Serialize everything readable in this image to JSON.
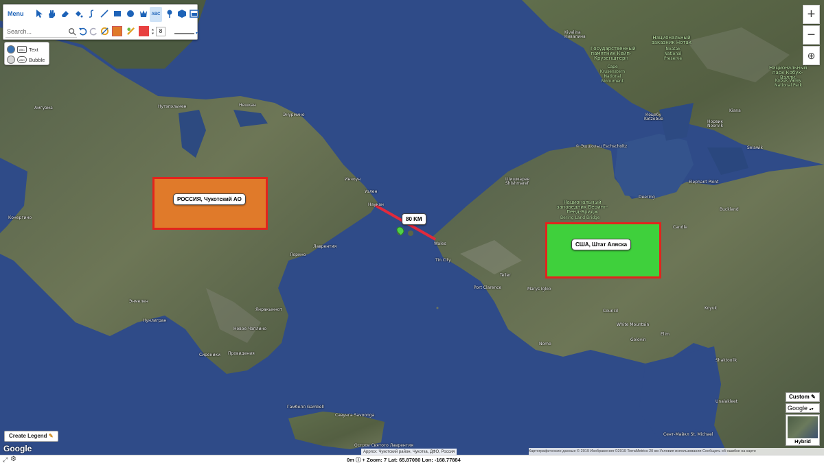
{
  "toolbar": {
    "menu_label": "Menu",
    "search_placeholder": "Search...",
    "abc_label": "ABC",
    "size_value": "8"
  },
  "layers": {
    "text_label": "Text",
    "bubble_label": "Bubble"
  },
  "zoom": {
    "in": "+",
    "out": "−"
  },
  "regions": {
    "russia": {
      "label": "РОССИЯ, Чукотский АО",
      "color": "#e07a2a"
    },
    "usa": {
      "label": "США, Штат Аляска",
      "color": "#3fd03c"
    }
  },
  "distance_label": "80 KM",
  "legend_button": "Create Legend",
  "google_logo": "Google",
  "maptype": {
    "custom": "Custom",
    "select": "Google",
    "hybrid": "Hybrid"
  },
  "approx": "Approx: Чукотский район, Чукотка, ДФО, Россия",
  "attribution": "Картографические данные © 2019 Изображения ©2019 TerraMetrics   20 км   Условия использования   Сообщить об ошибке на карте",
  "status": {
    "elevation": "0m",
    "zoom": "Zoom: 7",
    "lat": "Lat: 65.87080",
    "lon": "Lon: -168.77884"
  },
  "place_labels": {
    "kivalina": "Kivalina",
    "kivalina_ru": "Кивалина",
    "noatak_ru": "Национальный заказник Нотак",
    "noatak": "Noatak National Preserve",
    "krusenstern_ru": "Государственный памятник Кейп-Крузенштерн",
    "krusenstern": "Cape Krusenstern National Monument",
    "kobuk_ru": "Национальный парк Кобук-Вэлли",
    "kobuk": "Kobuk Valley National Park",
    "kotzebue": "Kotzebue",
    "kotzebue_ru": "Коцебу",
    "noorvik": "Noorvik",
    "noorvik_ru": "Норвик",
    "kiana": "Kiana",
    "selawik": "Selawik",
    "eschscholtz": "© Эшшольц Eschscholtz",
    "shishmaref": "Shishmaref",
    "shishmaref_ru": "Шишмарев",
    "deering": "Deering",
    "elephant_point": "Elephant Point",
    "bering_ru": "Национальный заповедник Беринг-Ленд-Бридж",
    "bering": "Bering Land Bridge",
    "candle": "Candle",
    "buckland": "Buckland",
    "koyuk": "Koyuk",
    "wales": "Wales",
    "tin_city": "Tin City",
    "teller": "Teller",
    "port_clarence": "Port Clarence",
    "marys_igloo": "Marys Igloo",
    "council": "Council",
    "white_mountain": "White Mountain",
    "golovin": "Golovin",
    "elim": "Elim",
    "nome": "Nome",
    "shaktoolik": "Shaktoolik",
    "unalakleet": "Unalakleet",
    "st_michael": "Сент-Майкл St. Michael",
    "gambell": "Гамбелл Gambell",
    "savoonga": "Савунга Savoonga",
    "st_lawrence": "Остров Святого Лаврентия",
    "uelen": "Уэлен",
    "naukan": "Наукан",
    "inchoun": "Инчоун",
    "enurmino": "Энурмино",
    "neshkan": "Нешкан",
    "nutepelmen": "Нутэпэльмен",
    "amguema": "Амгуэма",
    "lavrentiya": "Лаврентия",
    "lorino": "Лорино",
    "yanrakynnot": "Янракыннот",
    "enmelen": "Энмелен",
    "nunligran": "Нунлигран",
    "novoe_chaplino": "Новое Чаплино",
    "sireniki": "Сиреники",
    "provideniya": "Провидения",
    "konergino": "Конергино"
  }
}
